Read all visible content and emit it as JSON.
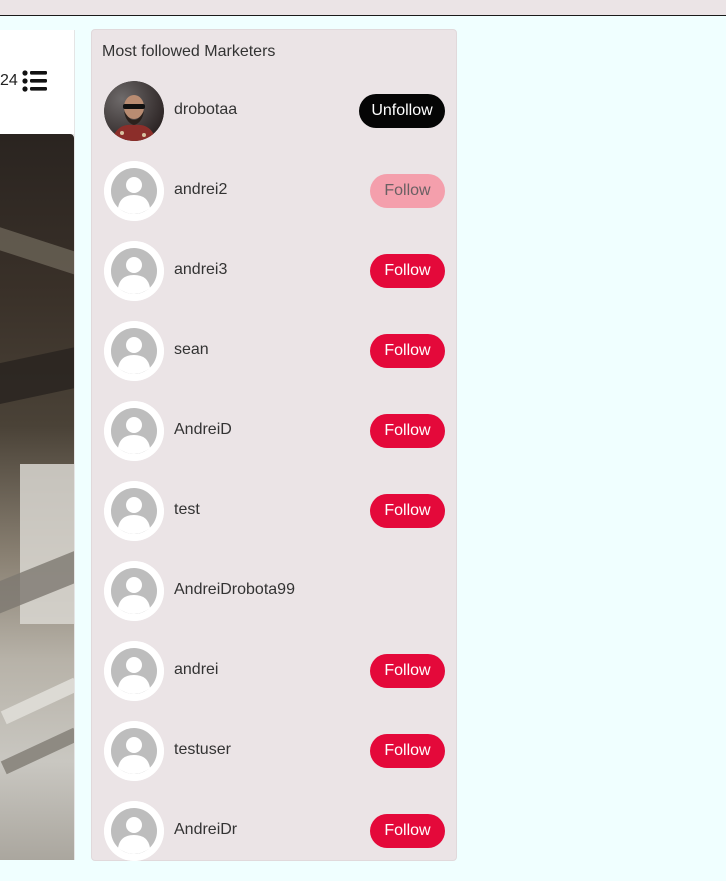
{
  "left": {
    "count_text": "24",
    "list_icon": "list-icon",
    "photo": "workspace-photo"
  },
  "panel": {
    "title": "Most followed Marketers",
    "marketers": [
      {
        "name": "drobotaa",
        "avatar": "profile-photo",
        "button": "Unfollow",
        "state": "unfollow"
      },
      {
        "name": "andrei2",
        "avatar": "default-avatar-icon",
        "button": "Follow",
        "state": "disabled"
      },
      {
        "name": "andrei3",
        "avatar": "default-avatar-icon",
        "button": "Follow",
        "state": "follow"
      },
      {
        "name": "sean",
        "avatar": "default-avatar-icon",
        "button": "Follow",
        "state": "follow"
      },
      {
        "name": "AndreiD",
        "avatar": "default-avatar-icon",
        "button": "Follow",
        "state": "follow"
      },
      {
        "name": "test",
        "avatar": "default-avatar-icon",
        "button": "Follow",
        "state": "follow"
      },
      {
        "name": "AndreiDrobota99",
        "avatar": "default-avatar-icon",
        "button": "",
        "state": "none"
      },
      {
        "name": "andrei",
        "avatar": "default-avatar-icon",
        "button": "Follow",
        "state": "follow"
      },
      {
        "name": "testuser",
        "avatar": "default-avatar-icon",
        "button": "Follow",
        "state": "follow"
      },
      {
        "name": "AndreiDr",
        "avatar": "default-avatar-icon",
        "button": "Follow",
        "state": "follow"
      }
    ]
  },
  "colors": {
    "follow": "#e4093a",
    "follow_disabled": "#f49fac",
    "unfollow": "#050505",
    "panel_bg": "#ebe4e6",
    "page_bg": "#f0ffff"
  }
}
